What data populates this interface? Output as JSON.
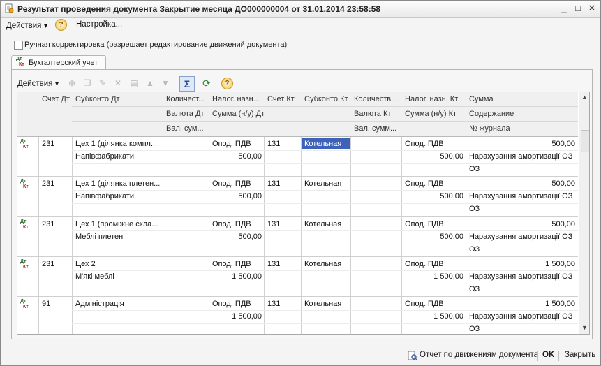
{
  "window": {
    "title": "Результат проведения документа Закрытие месяца ДО000000004 от 31.01.2014 23:58:58",
    "controls": [
      "_",
      "□",
      "✕"
    ]
  },
  "menu": {
    "actions": "Действия",
    "settings": "Настройка..."
  },
  "manual_correction_label": "Ручная корректировка (разрешает редактирование движений документа)",
  "tab": {
    "label": "Бухгалтерский учет",
    "icon_dt": "Дт",
    "icon_kt": "Кт"
  },
  "toolbar": {
    "actions": "Действия"
  },
  "columns": {
    "h1": [
      "Счет Дт",
      "Субконто Дт",
      "Количест...",
      "Налог. назн...",
      "Счет Кт",
      "Субконто Кт",
      "Количеств...",
      "Налог. назн. Кт",
      "Сумма"
    ],
    "h2": [
      "",
      "",
      "Валюта Дт",
      "Сумма (н/у) Дт",
      "",
      "",
      "Валюта Кт",
      "Сумма (н/у) Кт",
      "Содержание"
    ],
    "h3": [
      "",
      "",
      "Вал. сум...",
      "",
      "",
      "",
      "Вал. сумм...",
      "",
      "№ журнала"
    ]
  },
  "rows": [
    {
      "schet_dt": "231",
      "subkonto_dt": [
        "Цех 1 (ділянка компл...",
        "Напівфабрикати"
      ],
      "nalog_dt": "Опод. ПДВ",
      "summa_nu_dt": "500,00",
      "schet_kt": "131",
      "subkonto_kt": "Котельная",
      "nalog_kt": "Опод. ПДВ",
      "summa_nu_kt": "500,00",
      "summa": "500,00",
      "content": "Нарахування амортизації ОЗ",
      "journal": "ОЗ",
      "selected_kt": true
    },
    {
      "schet_dt": "231",
      "subkonto_dt": [
        "Цех 1 (ділянка плетен...",
        "Напівфабрикати"
      ],
      "nalog_dt": "Опод. ПДВ",
      "summa_nu_dt": "500,00",
      "schet_kt": "131",
      "subkonto_kt": "Котельная",
      "nalog_kt": "Опод. ПДВ",
      "summa_nu_kt": "500,00",
      "summa": "500,00",
      "content": "Нарахування амортизації ОЗ",
      "journal": "ОЗ",
      "selected_kt": false
    },
    {
      "schet_dt": "231",
      "subkonto_dt": [
        "Цех 1 (проміжне скла...",
        "Меблі плетені"
      ],
      "nalog_dt": "Опод. ПДВ",
      "summa_nu_dt": "500,00",
      "schet_kt": "131",
      "subkonto_kt": "Котельная",
      "nalog_kt": "Опод. ПДВ",
      "summa_nu_kt": "500,00",
      "summa": "500,00",
      "content": "Нарахування амортизації ОЗ",
      "journal": "ОЗ",
      "selected_kt": false
    },
    {
      "schet_dt": "231",
      "subkonto_dt": [
        "Цех 2",
        "М'які меблі"
      ],
      "nalog_dt": "Опод. ПДВ",
      "summa_nu_dt": "1 500,00",
      "schet_kt": "131",
      "subkonto_kt": "Котельная",
      "nalog_kt": "Опод. ПДВ",
      "summa_nu_kt": "1 500,00",
      "summa": "1 500,00",
      "content": "Нарахування амортизації ОЗ",
      "journal": "ОЗ",
      "selected_kt": false
    },
    {
      "schet_dt": "91",
      "subkonto_dt": [
        "Адміністрація",
        ""
      ],
      "nalog_dt": "Опод. ПДВ",
      "summa_nu_dt": "1 500,00",
      "schet_kt": "131",
      "subkonto_kt": "Котельная",
      "nalog_kt": "Опод. ПДВ",
      "summa_nu_kt": "1 500,00",
      "summa": "1 500,00",
      "content": "Нарахування амортизації ОЗ",
      "journal": "ОЗ",
      "selected_kt": false
    }
  ],
  "footer": {
    "report": "Отчет по движениям документа",
    "ok": "OK",
    "close": "Закрыть"
  }
}
